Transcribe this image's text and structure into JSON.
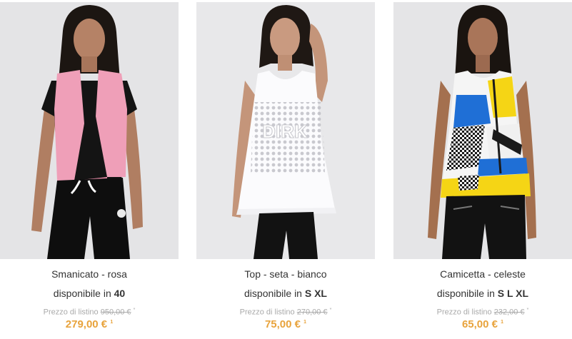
{
  "products": [
    {
      "name": "Smanicato - rosa",
      "availability_prefix": "disponibile in",
      "sizes": "40",
      "list_price_label": "Prezzo di listino",
      "list_price": "950,00 €",
      "list_price_mark": "*",
      "price": "279,00 €",
      "price_mark": "1",
      "image_icon": "product-photo-pink-vest"
    },
    {
      "name": "Top - seta - bianco",
      "availability_prefix": "disponibile in",
      "sizes": "S XL",
      "list_price_label": "Prezzo di listino",
      "list_price": "270,00 €",
      "list_price_mark": "*",
      "price": "75,00 €",
      "price_mark": "1",
      "image_icon": "product-photo-white-silk-top",
      "image_text": "DIRK"
    },
    {
      "name": "Camicetta - celeste",
      "availability_prefix": "disponibile in",
      "sizes": "S L XL",
      "list_price_label": "Prezzo di listino",
      "list_price": "232,00 €",
      "list_price_mark": "*",
      "price": "65,00 €",
      "price_mark": "1",
      "image_icon": "product-photo-patterned-blouse"
    }
  ],
  "colors": {
    "price": "#e8a33c",
    "list_price": "#aaaaaa",
    "text": "#333333",
    "photo_bg": "#e6e6e8"
  }
}
